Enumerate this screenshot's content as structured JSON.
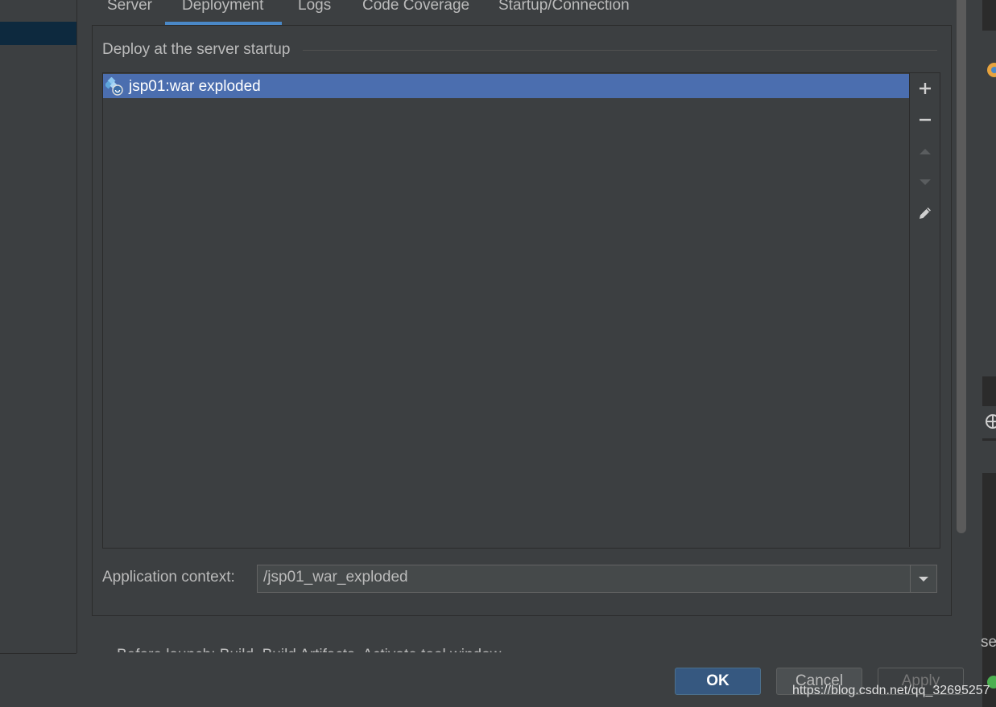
{
  "tabs": [
    {
      "label": "Server"
    },
    {
      "label": "Deployment",
      "selected": true
    },
    {
      "label": "Logs"
    },
    {
      "label": "Code Coverage"
    },
    {
      "label": "Startup/Connection"
    }
  ],
  "deploy_section": {
    "title": "Deploy at the server startup",
    "items": [
      {
        "label": "jsp01:war exploded",
        "icon": "artifact-exploded-icon",
        "selected": true
      }
    ],
    "toolbar": [
      "add-icon",
      "remove-icon",
      "move-up-icon",
      "move-down-icon",
      "edit-icon"
    ]
  },
  "app_context": {
    "label": "Application context:",
    "value": "/jsp01_war_exploded"
  },
  "before_launch_partial": "Before launch: Build, Build Artifacts, Activate tool window",
  "buttons": {
    "ok": "OK",
    "cancel": "Cancel",
    "apply": "Apply"
  },
  "watermark": "https://blog.csdn.net/qq_32695257",
  "right_strip_partial_text": "se",
  "colors": {
    "background": "#3c3f41",
    "selection": "#4b6eaf",
    "tab_underline": "#4a88c7",
    "ok_button": "#365880",
    "text": "#bbbbbb"
  }
}
